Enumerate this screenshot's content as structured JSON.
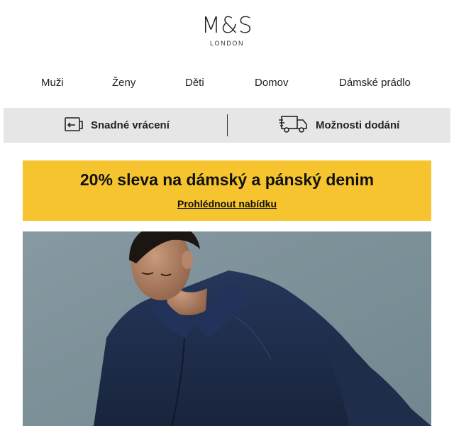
{
  "brand": {
    "name": "M&S",
    "subtitle": "LONDON"
  },
  "nav": {
    "items": [
      {
        "label": "Muži"
      },
      {
        "label": "Ženy"
      },
      {
        "label": "Děti"
      },
      {
        "label": "Domov"
      },
      {
        "label": "Dámské prádlo"
      }
    ]
  },
  "services": {
    "returns": {
      "label": "Snadné vrácení",
      "icon": "return-package-icon"
    },
    "delivery": {
      "label": "Možnosti dodání",
      "icon": "delivery-truck-icon"
    }
  },
  "promo": {
    "title": "20% sleva na dámský a pánský denim",
    "link": "Prohlédnout nabídku",
    "color": "#f6c42e"
  },
  "hero": {
    "background_color": "#7f949e",
    "jacket_color": "#1d2b45"
  }
}
